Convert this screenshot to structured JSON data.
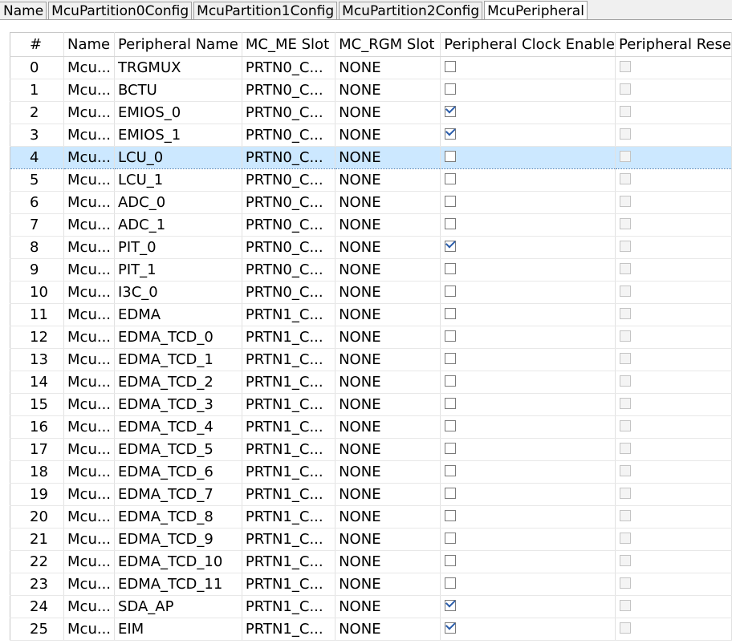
{
  "tabs": [
    {
      "label": "Name",
      "active": false
    },
    {
      "label": "McuPartition0Config",
      "active": false
    },
    {
      "label": "McuPartition1Config",
      "active": false
    },
    {
      "label": "McuPartition2Config",
      "active": false
    },
    {
      "label": "McuPeripheral",
      "active": true
    }
  ],
  "table": {
    "columns": [
      "#",
      "Name",
      "Peripheral Name",
      "MC_ME Slot",
      "MC_RGM Slot",
      "Peripheral Clock Enable",
      "Peripheral Rese"
    ],
    "selected_row": 4,
    "colors": {
      "selected": "#cce8ff",
      "check": "#2a5caa"
    },
    "rows": [
      {
        "idx": "0",
        "name": "Mcu...",
        "periph": "TRGMUX",
        "me": "PRTN0_C...",
        "rgm": "NONE",
        "clk": false
      },
      {
        "idx": "1",
        "name": "Mcu...",
        "periph": "BCTU",
        "me": "PRTN0_C...",
        "rgm": "NONE",
        "clk": false
      },
      {
        "idx": "2",
        "name": "Mcu...",
        "periph": "EMIOS_0",
        "me": "PRTN0_C...",
        "rgm": "NONE",
        "clk": true
      },
      {
        "idx": "3",
        "name": "Mcu...",
        "periph": "EMIOS_1",
        "me": "PRTN0_C...",
        "rgm": "NONE",
        "clk": true
      },
      {
        "idx": "4",
        "name": "Mcu...",
        "periph": "LCU_0",
        "me": "PRTN0_C...",
        "rgm": "NONE",
        "clk": false
      },
      {
        "idx": "5",
        "name": "Mcu...",
        "periph": "LCU_1",
        "me": "PRTN0_C...",
        "rgm": "NONE",
        "clk": false
      },
      {
        "idx": "6",
        "name": "Mcu...",
        "periph": "ADC_0",
        "me": "PRTN0_C...",
        "rgm": "NONE",
        "clk": false
      },
      {
        "idx": "7",
        "name": "Mcu...",
        "periph": "ADC_1",
        "me": "PRTN0_C...",
        "rgm": "NONE",
        "clk": false
      },
      {
        "idx": "8",
        "name": "Mcu...",
        "periph": "PIT_0",
        "me": "PRTN0_C...",
        "rgm": "NONE",
        "clk": true
      },
      {
        "idx": "9",
        "name": "Mcu...",
        "periph": "PIT_1",
        "me": "PRTN0_C...",
        "rgm": "NONE",
        "clk": false
      },
      {
        "idx": "10",
        "name": "Mcu...",
        "periph": "I3C_0",
        "me": "PRTN0_C...",
        "rgm": "NONE",
        "clk": false
      },
      {
        "idx": "11",
        "name": "Mcu...",
        "periph": "EDMA",
        "me": "PRTN1_C...",
        "rgm": "NONE",
        "clk": false
      },
      {
        "idx": "12",
        "name": "Mcu...",
        "periph": "EDMA_TCD_0",
        "me": "PRTN1_C...",
        "rgm": "NONE",
        "clk": false
      },
      {
        "idx": "13",
        "name": "Mcu...",
        "periph": "EDMA_TCD_1",
        "me": "PRTN1_C...",
        "rgm": "NONE",
        "clk": false
      },
      {
        "idx": "14",
        "name": "Mcu...",
        "periph": "EDMA_TCD_2",
        "me": "PRTN1_C...",
        "rgm": "NONE",
        "clk": false
      },
      {
        "idx": "15",
        "name": "Mcu...",
        "periph": "EDMA_TCD_3",
        "me": "PRTN1_C...",
        "rgm": "NONE",
        "clk": false
      },
      {
        "idx": "16",
        "name": "Mcu...",
        "periph": "EDMA_TCD_4",
        "me": "PRTN1_C...",
        "rgm": "NONE",
        "clk": false
      },
      {
        "idx": "17",
        "name": "Mcu...",
        "periph": "EDMA_TCD_5",
        "me": "PRTN1_C...",
        "rgm": "NONE",
        "clk": false
      },
      {
        "idx": "18",
        "name": "Mcu...",
        "periph": "EDMA_TCD_6",
        "me": "PRTN1_C...",
        "rgm": "NONE",
        "clk": false
      },
      {
        "idx": "19",
        "name": "Mcu...",
        "periph": "EDMA_TCD_7",
        "me": "PRTN1_C...",
        "rgm": "NONE",
        "clk": false
      },
      {
        "idx": "20",
        "name": "Mcu...",
        "periph": "EDMA_TCD_8",
        "me": "PRTN1_C...",
        "rgm": "NONE",
        "clk": false
      },
      {
        "idx": "21",
        "name": "Mcu...",
        "periph": "EDMA_TCD_9",
        "me": "PRTN1_C...",
        "rgm": "NONE",
        "clk": false
      },
      {
        "idx": "22",
        "name": "Mcu...",
        "periph": "EDMA_TCD_10",
        "me": "PRTN1_C...",
        "rgm": "NONE",
        "clk": false
      },
      {
        "idx": "23",
        "name": "Mcu...",
        "periph": "EDMA_TCD_11",
        "me": "PRTN1_C...",
        "rgm": "NONE",
        "clk": false
      },
      {
        "idx": "24",
        "name": "Mcu...",
        "periph": "SDA_AP",
        "me": "PRTN1_C...",
        "rgm": "NONE",
        "clk": true
      },
      {
        "idx": "25",
        "name": "Mcu...",
        "periph": "EIM",
        "me": "PRTN1_C...",
        "rgm": "NONE",
        "clk": true
      }
    ]
  }
}
